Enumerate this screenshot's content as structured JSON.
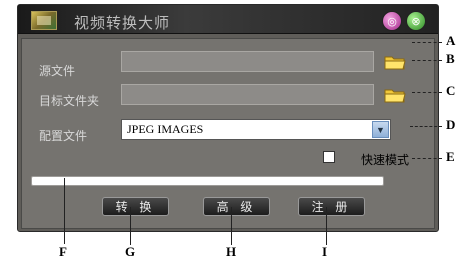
{
  "window": {
    "title": "视频转换大师"
  },
  "form": {
    "source_label": "源文件",
    "source_value": "",
    "target_label": "目标文件夹",
    "target_value": "",
    "config_label": "配置文件",
    "config_selected": "JPEG IMAGES",
    "fast_mode_label": "快速模式",
    "fast_mode_checked": false
  },
  "progress": {
    "value": 0
  },
  "buttons": {
    "convert": "转 换",
    "advanced": "高 级",
    "register": "注 册"
  },
  "callouts": {
    "A": "A",
    "B": "B",
    "C": "C",
    "D": "D",
    "E": "E",
    "F": "F",
    "G": "G",
    "H": "H",
    "I": "I"
  }
}
